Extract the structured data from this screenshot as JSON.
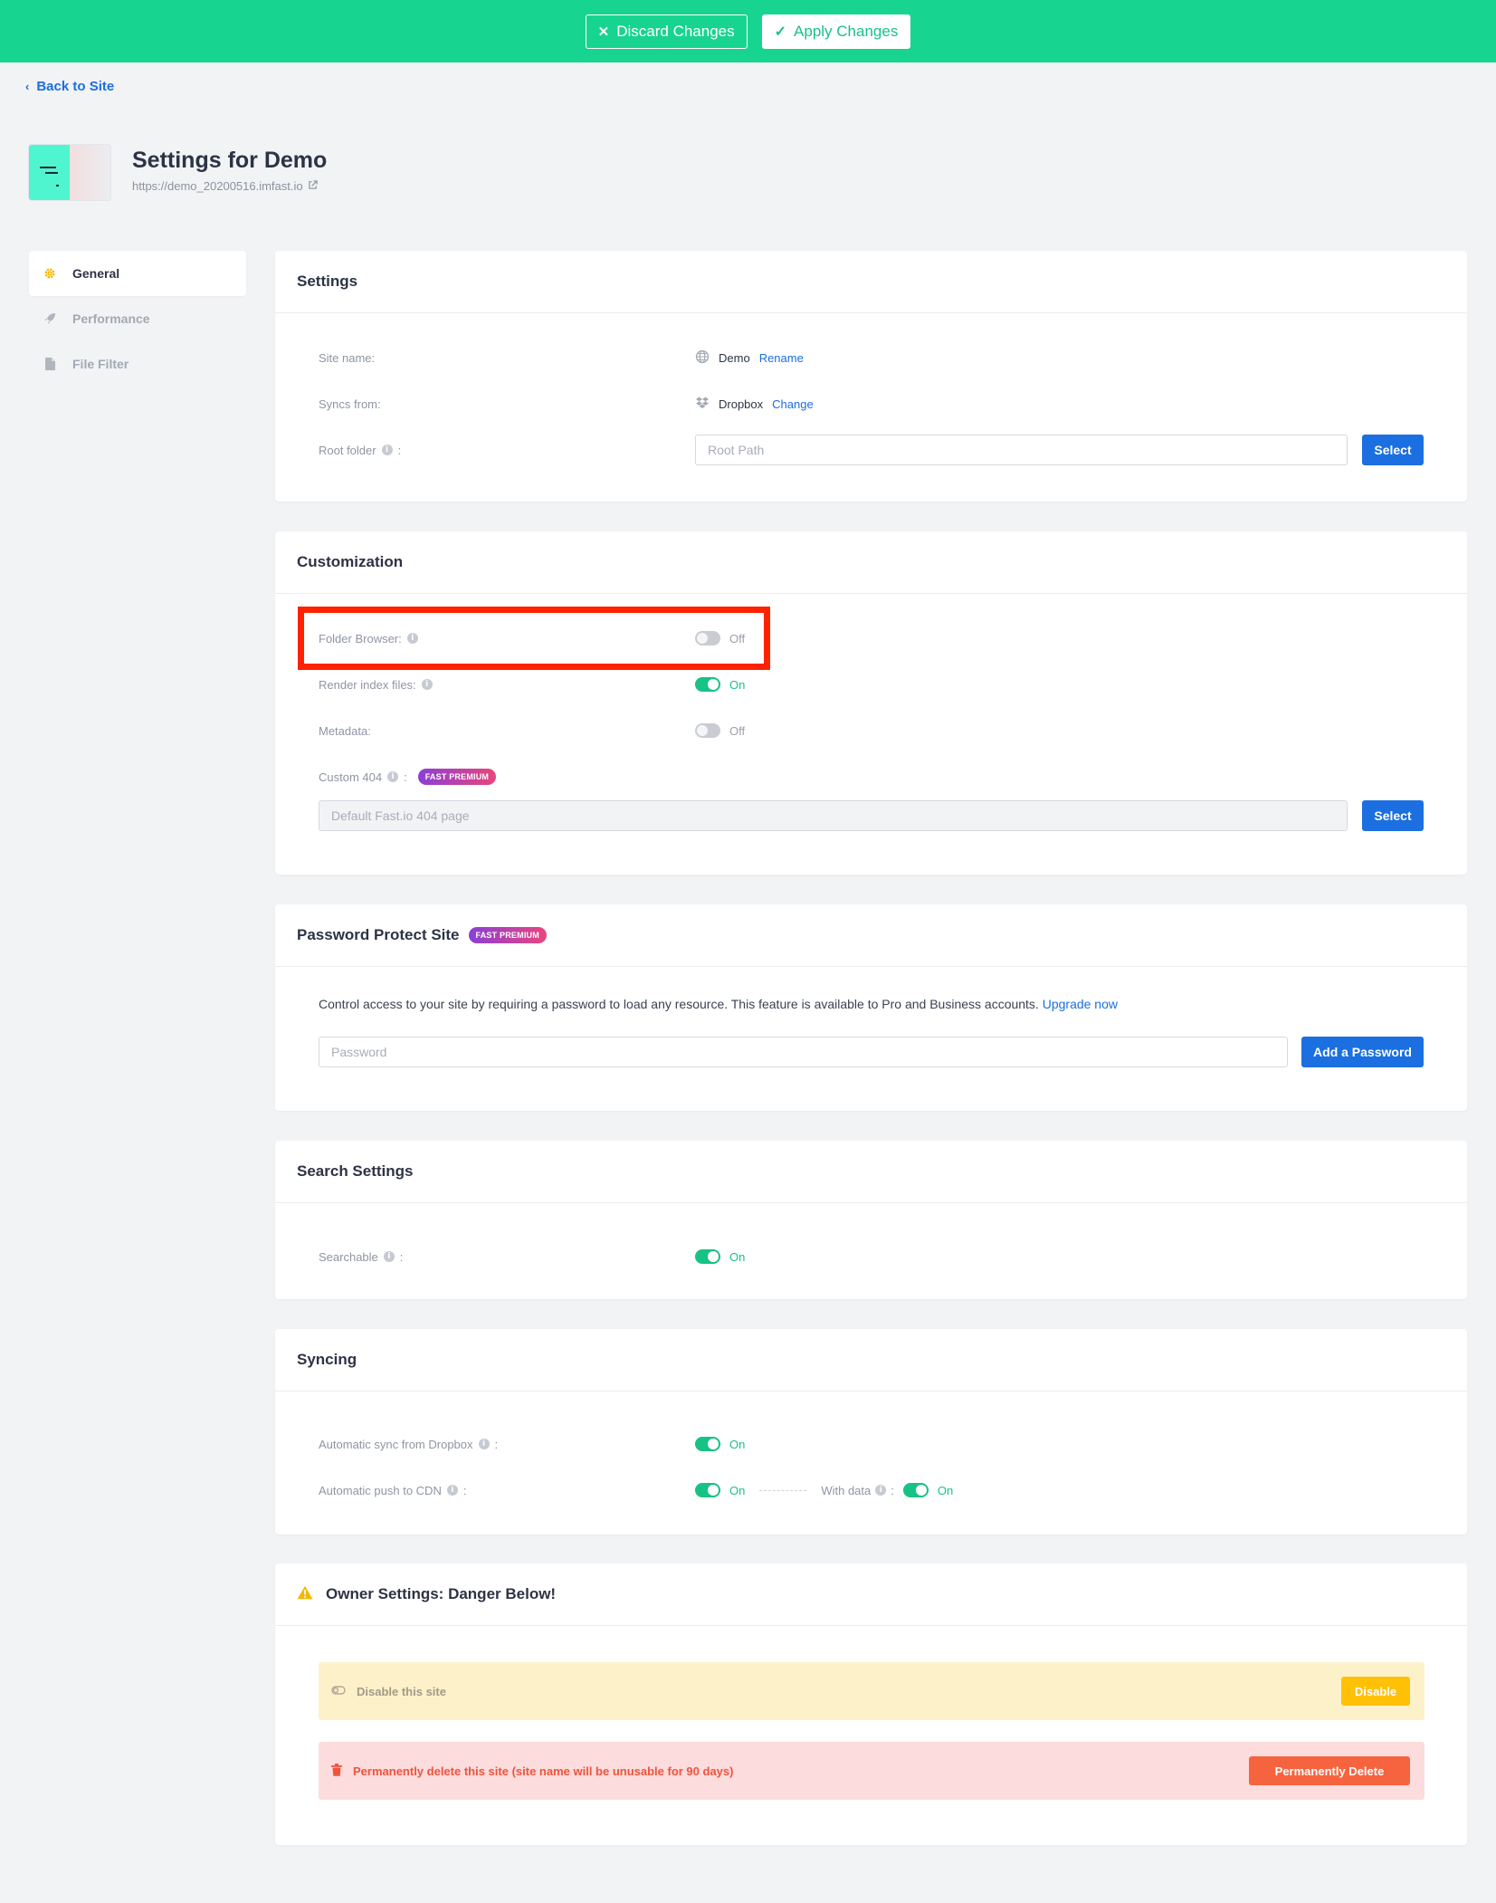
{
  "topbar": {
    "discard_label": "Discard Changes",
    "apply_label": "Apply Changes"
  },
  "back_label": "Back to Site",
  "site": {
    "title": "Settings for Demo",
    "url": "https://demo_20200516.imfast.io"
  },
  "sidebar": {
    "items": [
      {
        "label": "General",
        "icon": "gear-icon",
        "active": true
      },
      {
        "label": "Performance",
        "icon": "rocket-icon",
        "active": false
      },
      {
        "label": "File Filter",
        "icon": "file-icon",
        "active": false
      }
    ]
  },
  "settings": {
    "title": "Settings",
    "site_name_label": "Site name:",
    "site_name_value": "Demo",
    "rename_label": "Rename",
    "syncs_from_label": "Syncs from:",
    "syncs_from_value": "Dropbox",
    "change_label": "Change",
    "root_folder_label": "Root folder",
    "root_path_placeholder": "Root Path",
    "select_label": "Select"
  },
  "customization": {
    "title": "Customization",
    "folder_browser_label": "Folder Browser:",
    "folder_browser_state": "Off",
    "render_index_label": "Render index files:",
    "render_index_state": "On",
    "metadata_label": "Metadata:",
    "metadata_state": "Off",
    "custom404_label": "Custom 404",
    "premium_badge": "FAST PREMIUM",
    "custom404_placeholder": "Default Fast.io 404 page",
    "select_label": "Select"
  },
  "password": {
    "title": "Password Protect Site",
    "premium_badge": "FAST PREMIUM",
    "description": "Control access to your site by requiring a password to load any resource. This feature is available to Pro and Business accounts.",
    "upgrade_label": "Upgrade now",
    "placeholder": "Password",
    "add_label": "Add a Password"
  },
  "search": {
    "title": "Search Settings",
    "searchable_label": "Searchable",
    "searchable_state": "On"
  },
  "syncing": {
    "title": "Syncing",
    "auto_sync_label": "Automatic sync from Dropbox",
    "auto_sync_state": "On",
    "auto_push_label": "Automatic push to CDN",
    "auto_push_state": "On",
    "with_data_label": "With data",
    "with_data_state": "On"
  },
  "owner": {
    "title": "Owner Settings: Danger Below!",
    "disable_text": "Disable this site",
    "disable_button": "Disable",
    "delete_text": "Permanently delete this site (site name will be unusable for 90 days)",
    "delete_button": "Permanently Delete"
  },
  "colors": {
    "accent": "#17d490",
    "primary": "#1b6fe0",
    "highlight": "#ff2200",
    "warning": "#ffc107",
    "danger": "#f5643f"
  }
}
